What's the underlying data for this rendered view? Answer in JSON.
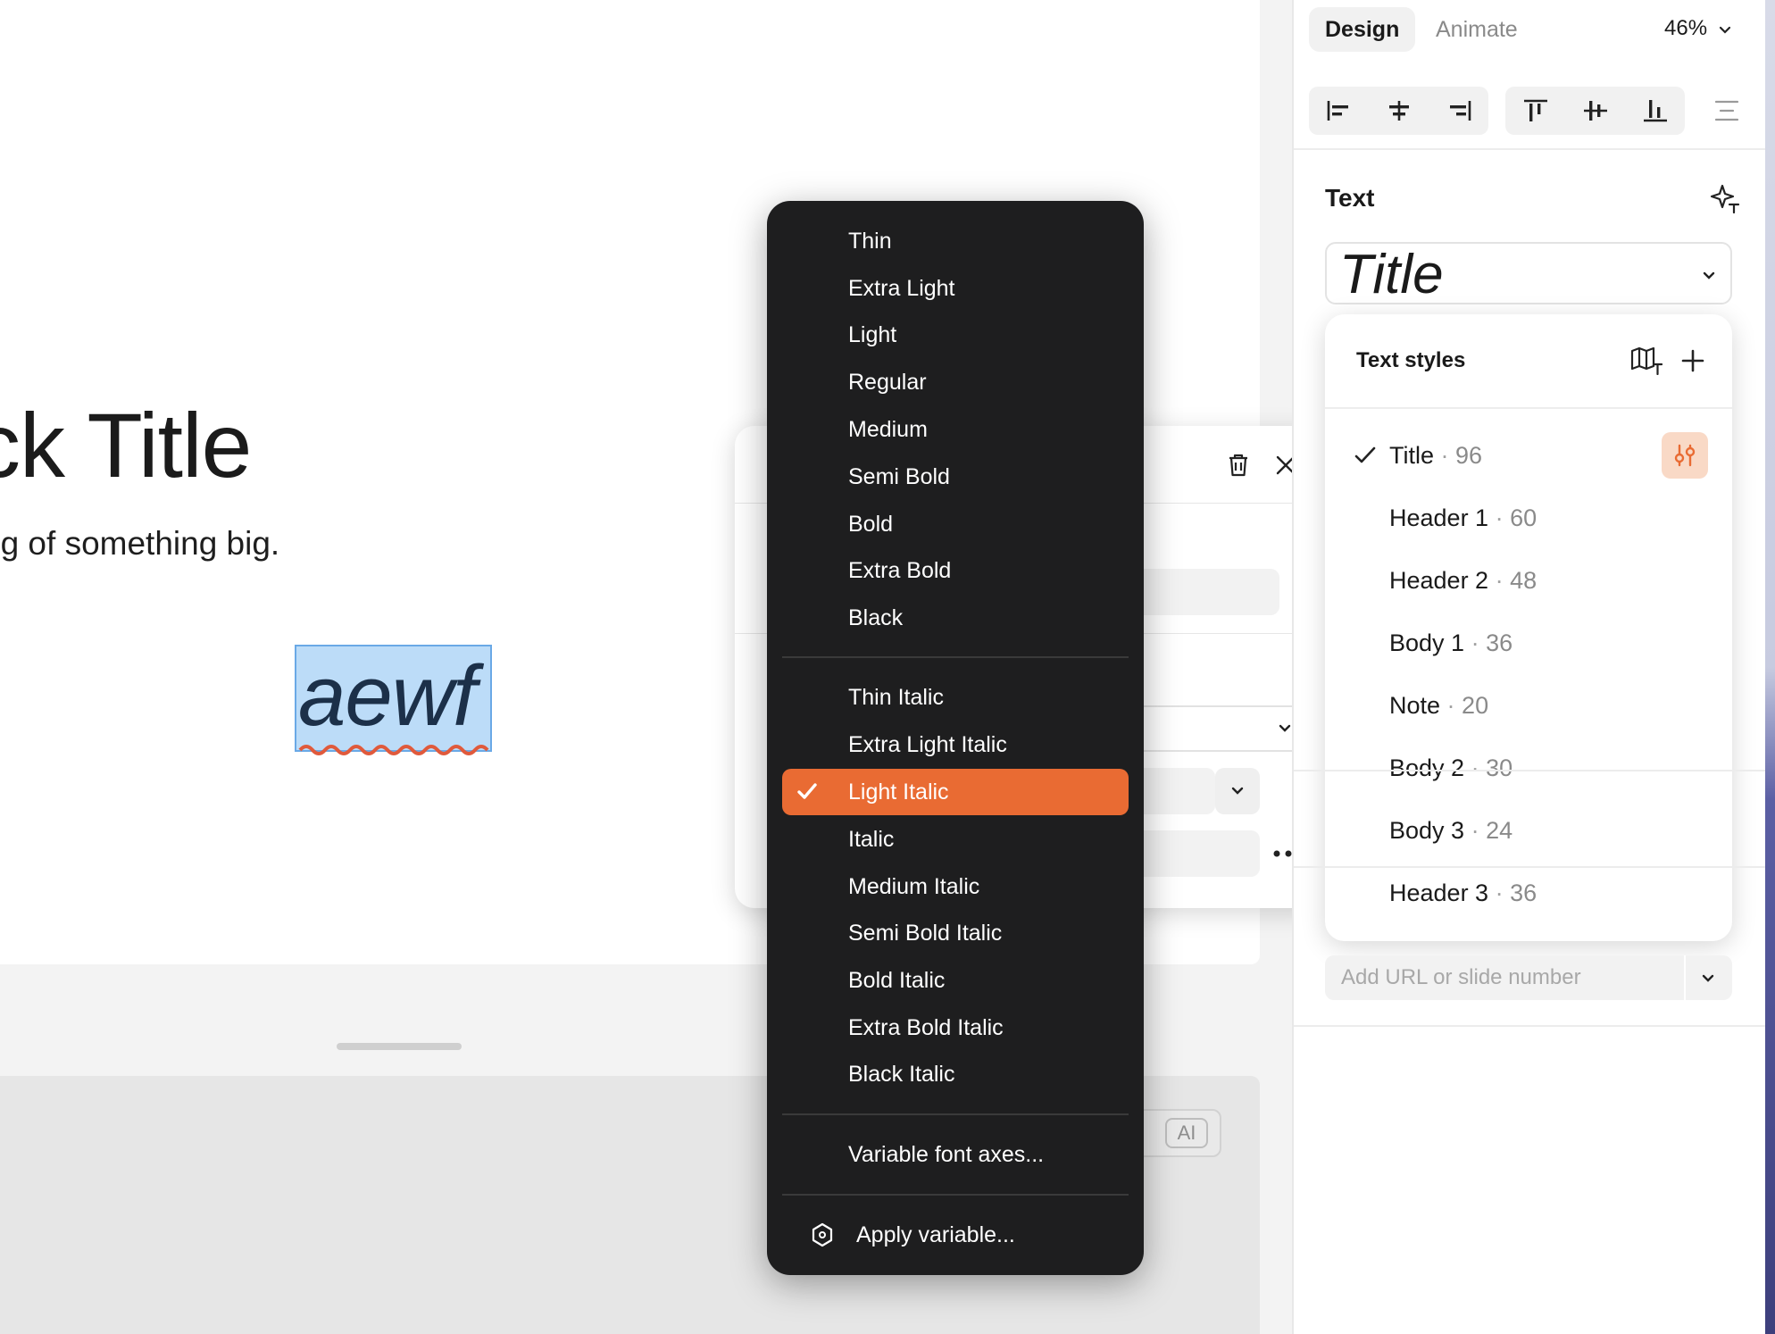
{
  "slide": {
    "title": "ck Title",
    "subtitle": "ng of something big.",
    "selected_text": "aewf",
    "ai_chip": "AI"
  },
  "weight_menu": {
    "items": [
      "Thin",
      "Extra Light",
      "Light",
      "Regular",
      "Medium",
      "Semi Bold",
      "Bold",
      "Extra Bold",
      "Black"
    ],
    "italic_items": [
      "Thin Italic",
      "Extra Light Italic",
      "Light Italic",
      "Italic",
      "Medium Italic",
      "Semi Bold Italic",
      "Bold Italic",
      "Extra Bold Italic",
      "Black Italic"
    ],
    "selected": "Light Italic",
    "variable_axes": "Variable font axes...",
    "apply_variable": "Apply variable..."
  },
  "inspector": {
    "tabs": {
      "design": "Design",
      "animate": "Animate"
    },
    "zoom": "46%",
    "text_section": "Text",
    "text_style_value": "Title",
    "url_placeholder": "Add URL or slide number"
  },
  "text_styles": {
    "heading": "Text styles",
    "items": [
      {
        "name": "Title",
        "size": "96",
        "checked": true
      },
      {
        "name": "Header 1",
        "size": "60"
      },
      {
        "name": "Header 2",
        "size": "48"
      },
      {
        "name": "Body 1",
        "size": "36"
      },
      {
        "name": "Note",
        "size": "20"
      },
      {
        "name": "Body 2",
        "size": "30"
      },
      {
        "name": "Body 3",
        "size": "24"
      },
      {
        "name": "Header 3",
        "size": "36"
      }
    ]
  },
  "colors": {
    "accent": "#e96b33",
    "menu_bg": "#1e1e1f",
    "selection": "#bcdcf8"
  }
}
